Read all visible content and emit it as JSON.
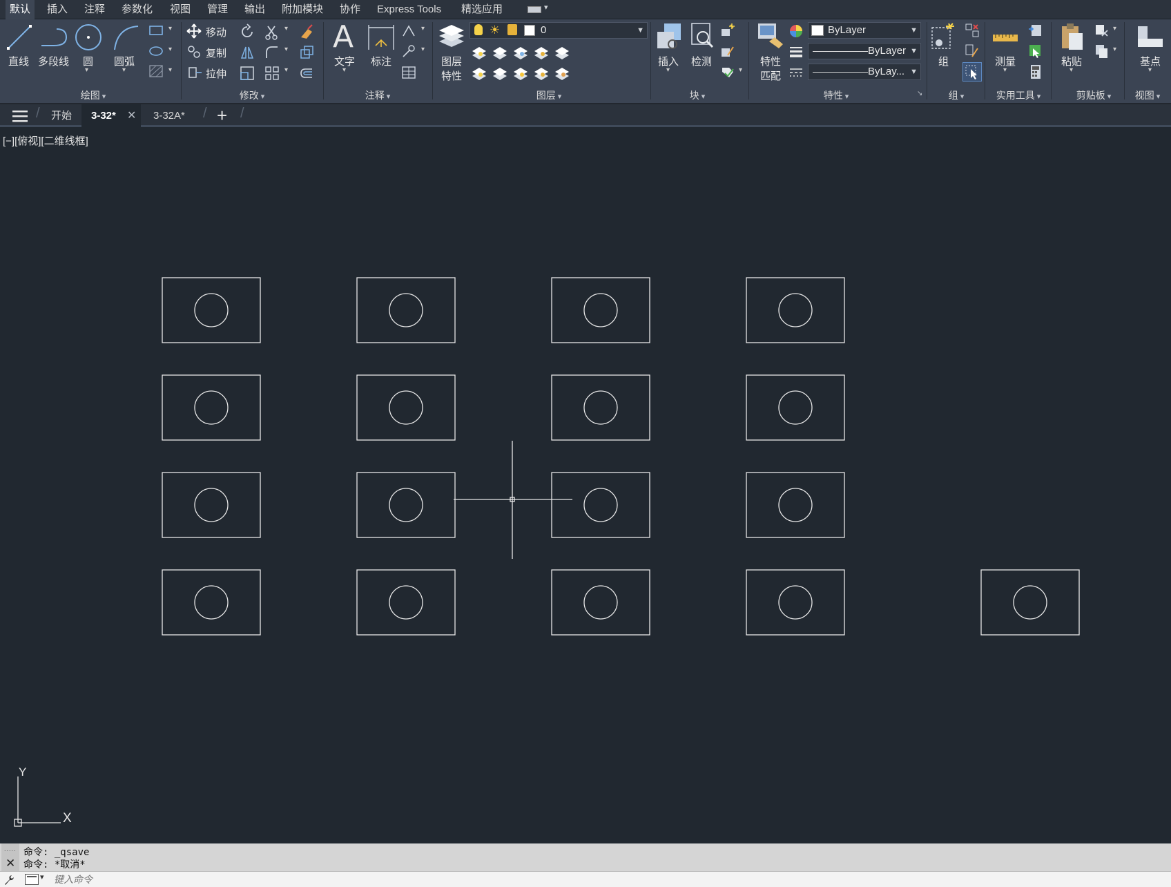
{
  "menubar": {
    "tabs": [
      "默认",
      "插入",
      "注释",
      "参数化",
      "视图",
      "管理",
      "输出",
      "附加模块",
      "协作",
      "Express Tools",
      "精选应用"
    ]
  },
  "ribbon": {
    "draw": {
      "title": "绘图",
      "line": "直线",
      "polyline": "多段线",
      "circle": "圆",
      "arc": "圆弧"
    },
    "modify": {
      "title": "修改",
      "move": "移动",
      "copy": "复制",
      "stretch": "拉伸"
    },
    "annotation": {
      "title": "注释",
      "text": "文字",
      "dimension": "标注"
    },
    "layers": {
      "title": "图层",
      "layer_props_line1": "图层",
      "layer_props_line2": "特性",
      "current_layer": "0"
    },
    "block": {
      "title": "块",
      "insert": "插入",
      "inspect": "检测"
    },
    "properties": {
      "title": "特性",
      "match_line1": "特性",
      "match_line2": "匹配",
      "color": "ByLayer",
      "lineweight": "ByLayer",
      "linetype": "ByLay..."
    },
    "groups": {
      "title": "组",
      "group": "组"
    },
    "utilities": {
      "title": "实用工具",
      "measure": "测量"
    },
    "clipboard": {
      "title": "剪贴板",
      "paste": "粘贴"
    },
    "view": {
      "title": "视图",
      "basepoint": "基点"
    }
  },
  "tabs": {
    "start": "开始",
    "doc1": "3-32*",
    "doc2": "3-32A*",
    "add": "+"
  },
  "viewport": {
    "label": "[−][俯视][二维线框]"
  },
  "ucs": {
    "x": "X",
    "y": "Y"
  },
  "command": {
    "history": [
      "命令: _qsave",
      "命令: *取消*"
    ],
    "placeholder": "键入命令"
  },
  "colors": {
    "background": "#212830",
    "ribbon": "#3b4453",
    "drawing_line": "#e8e8e8"
  }
}
